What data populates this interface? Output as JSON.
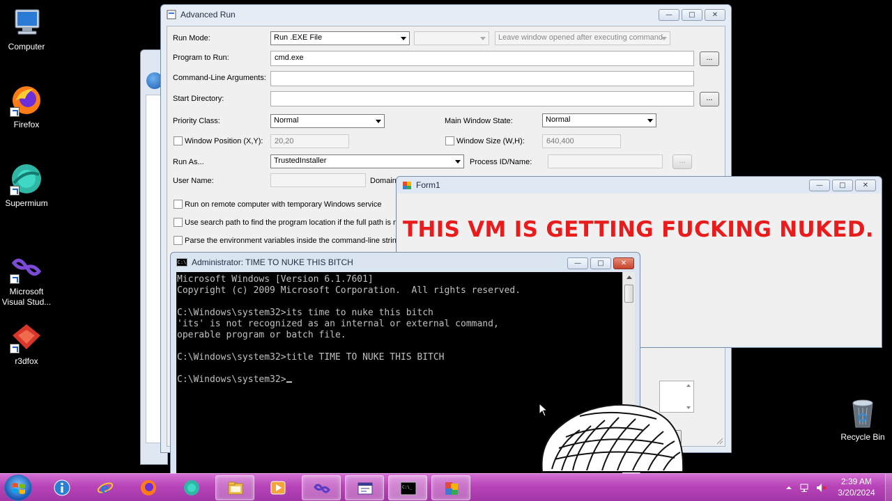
{
  "desktop": {
    "icons": [
      {
        "label": "Computer",
        "icon": "computer-icon"
      },
      {
        "label": "Firefox",
        "icon": "firefox-icon"
      },
      {
        "label": "Supermium",
        "icon": "supermium-icon"
      },
      {
        "label": "Microsoft Visual Stud...",
        "icon": "visual-studio-icon"
      },
      {
        "label": "r3dfox",
        "icon": "r3dfox-icon"
      }
    ],
    "recycle_bin": {
      "label": "Recycle Bin",
      "icon": "recycle-bin-icon"
    }
  },
  "advanced_run": {
    "title": "Advanced Run",
    "run_mode_label": "Run Mode:",
    "run_mode_value": "Run .EXE File",
    "run_mode_extra_value": "",
    "leave_window_value": "Leave window opened after executing command",
    "program_label": "Program to Run:",
    "program_value": "cmd.exe",
    "browse_label": "...",
    "args_label": "Command-Line Arguments:",
    "args_value": "",
    "start_dir_label": "Start Directory:",
    "start_dir_value": "",
    "priority_label": "Priority Class:",
    "priority_value": "Normal",
    "main_window_state_label": "Main Window State:",
    "main_window_state_value": "Normal",
    "window_position_label": "Window Position (X,Y):",
    "window_position_value": "20,20",
    "window_size_label": "Window Size (W,H):",
    "window_size_value": "640,400",
    "run_as_label": "Run As...",
    "run_as_value": "TrustedInstaller",
    "process_id_label": "Process ID/Name:",
    "process_id_value": "",
    "user_name_label": "User Name:",
    "user_name_value": "",
    "domain_label": "Domain:",
    "opt_remote_label": "Run on remote computer with temporary Windows service",
    "opt_search_path_label": "Use search path to find the program location if the full path is no",
    "opt_parse_env_label": "Parse the environment variables inside the command-line string"
  },
  "form1": {
    "title": "Form1",
    "message": "THIS VM IS GETTING FUCKING NUKED.",
    "accent_color": "#e81c1c"
  },
  "cmd": {
    "title": "Administrator:  TIME TO NUKE THIS BITCH",
    "lines": [
      "Microsoft Windows [Version 6.1.7601]",
      "Copyright (c) 2009 Microsoft Corporation.  All rights reserved.",
      "",
      "C:\\Windows\\system32>its time to nuke this bitch",
      "'its' is not recognized as an internal or external command,",
      "operable program or batch file.",
      "",
      "C:\\Windows\\system32>title TIME TO NUKE THIS BITCH",
      "",
      "C:\\Windows\\system32>"
    ]
  },
  "taskbar": {
    "color": "#b844b8",
    "items": [
      {
        "name": "windows-help-icon"
      },
      {
        "name": "internet-explorer-icon"
      },
      {
        "name": "firefox-icon"
      },
      {
        "name": "supermium-icon"
      },
      {
        "name": "file-explorer-icon"
      },
      {
        "name": "media-player-icon"
      },
      {
        "name": "visual-studio-icon"
      },
      {
        "name": "advanced-run-icon"
      },
      {
        "name": "command-prompt-icon"
      },
      {
        "name": "form-app-icon"
      }
    ],
    "clock_time": "2:39 AM",
    "clock_date": "3/20/2024"
  }
}
